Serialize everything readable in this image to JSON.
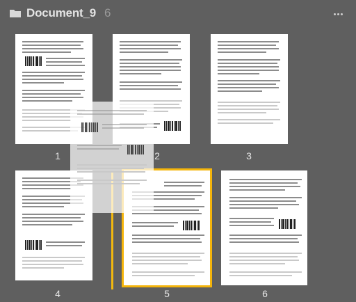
{
  "header": {
    "title": "Document_9",
    "count": "6"
  },
  "pages": [
    {
      "label": "1"
    },
    {
      "label": "2"
    },
    {
      "label": "3"
    },
    {
      "label": "4"
    },
    {
      "label": "5",
      "selected": true
    },
    {
      "label": "6"
    }
  ],
  "icons": {
    "folder": "folder-icon",
    "more": "more-options-icon"
  },
  "colors": {
    "background": "#5f5f5f",
    "selection": "#f5b50b",
    "title": "#e3e3e3"
  }
}
